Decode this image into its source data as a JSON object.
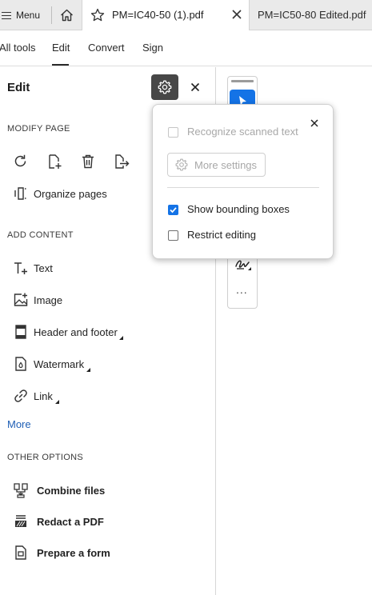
{
  "tabbar": {
    "menu_label": "Menu",
    "active_tab_title": "PM=IC40-50 (1).pdf",
    "inactive_tab_title": "PM=IC50-80 Edited.pdf"
  },
  "menubar": {
    "items": [
      "All tools",
      "Edit",
      "Convert",
      "Sign"
    ],
    "selected": "Edit"
  },
  "panel": {
    "title": "Edit",
    "modify_section": "MODIFY PAGE",
    "organize_label": "Organize pages",
    "add_section": "ADD CONTENT",
    "add_items": [
      "Text",
      "Image",
      "Header and footer",
      "Watermark",
      "Link"
    ],
    "more_label": "More",
    "other_section": "OTHER OPTIONS",
    "other_items": [
      "Combine files",
      "Redact a PDF",
      "Prepare a form"
    ]
  },
  "popover": {
    "recognize_label": "Recognize scanned text",
    "recognize_checked": false,
    "recognize_enabled": false,
    "more_settings_label": "More settings",
    "bounding_label": "Show bounding boxes",
    "bounding_checked": true,
    "restrict_label": "Restrict editing",
    "restrict_checked": false
  },
  "toolbar": {
    "more_tools_label": "..."
  },
  "colors": {
    "accent": "#1473e6",
    "gear_button_bg": "#474747",
    "link": "#1f5fb5"
  },
  "icons": {
    "menu": "hamburger-icon",
    "home": "home-icon",
    "star": "star-icon",
    "tab_close": "close-icon",
    "settings": "gear-icon",
    "rotate": "rotate-icon",
    "insert_page": "insert-page-icon",
    "delete_page": "trash-icon",
    "extract_page": "extract-page-icon",
    "organize": "organize-pages-icon",
    "text": "add-text-icon",
    "image": "image-icon",
    "header_footer": "header-footer-icon",
    "watermark": "watermark-icon",
    "link": "link-icon",
    "combine": "combine-files-icon",
    "redact": "redact-icon",
    "prepare_form": "prepare-form-icon",
    "select": "cursor-icon",
    "signature": "signature-icon"
  }
}
